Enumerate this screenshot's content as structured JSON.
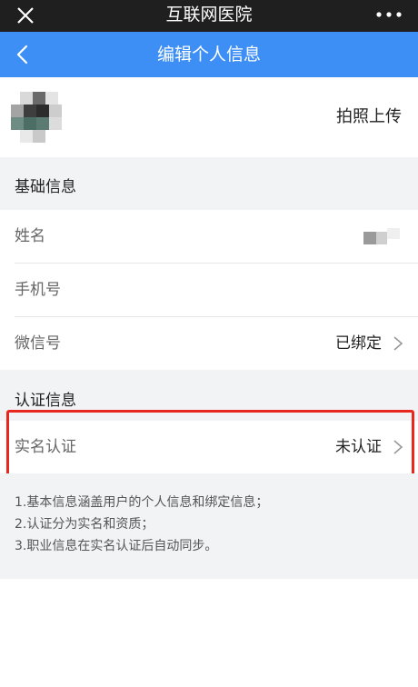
{
  "window": {
    "title": "互联网医院",
    "close_icon": "close-icon",
    "more_icon": "more-icon"
  },
  "nav": {
    "title": "编辑个人信息",
    "back_icon": "chevron-left-icon",
    "color": "#3d8ff5"
  },
  "avatar_row": {
    "upload_label": "拍照上传"
  },
  "basic": {
    "title": "基础信息",
    "rows": [
      {
        "label": "姓名",
        "value": ""
      },
      {
        "label": "手机号",
        "value": ""
      },
      {
        "label": "微信号",
        "value": "已绑定"
      }
    ]
  },
  "auth": {
    "title": "认证信息",
    "rows": [
      {
        "label": "实名认证",
        "value": "未认证"
      }
    ],
    "highlight_color": "#e8281f"
  },
  "notes": [
    "1.基本信息涵盖用户的个人信息和绑定信息；",
    "2.认证分为实名和资质；",
    "3.职业信息在实名认证后自动同步。"
  ]
}
